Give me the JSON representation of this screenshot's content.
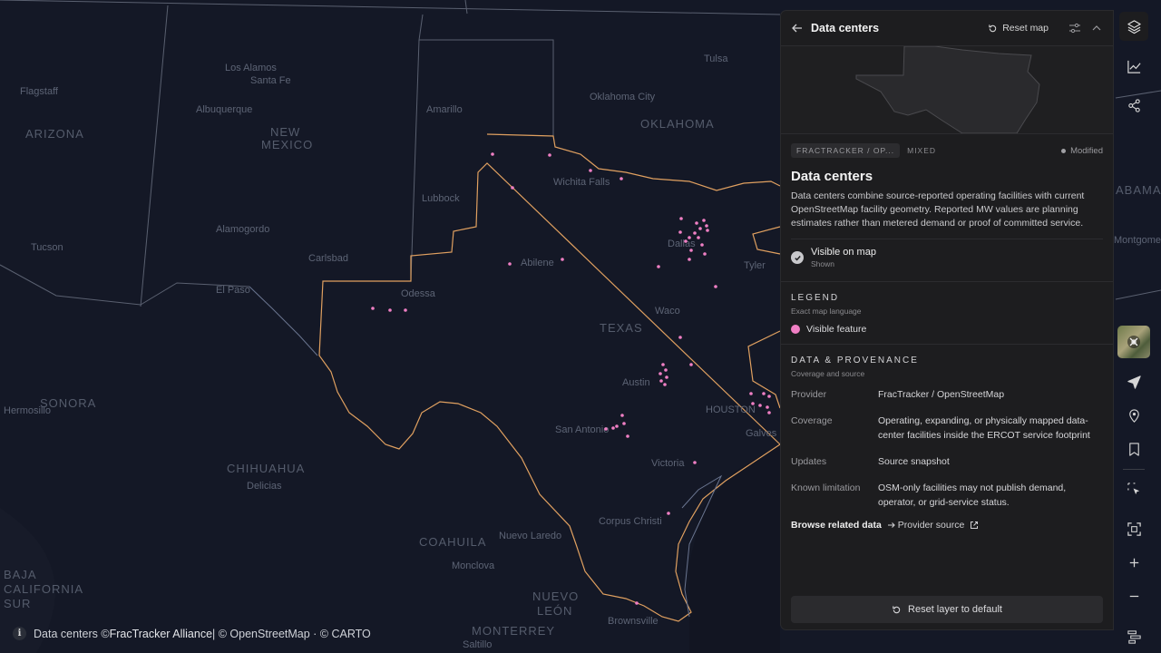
{
  "map": {
    "places": {
      "las_alamos": "Los Alamos",
      "santa_fe": "Santa Fe",
      "albuquerque": "Albuquerque",
      "flagstaff": "Flagstaff",
      "tulsa": "Tulsa",
      "oklahoma_city": "Oklahoma City",
      "amarillo": "Amarillo",
      "wichita_falls": "Wichita Falls",
      "lubbock": "Lubbock",
      "alamogordo": "Alamogordo",
      "carlsbad": "Carlsbad",
      "abilene": "Abilene",
      "dallas": "Dallas",
      "tyler": "Tyler",
      "el_paso": "El Paso",
      "odessa": "Odessa",
      "waco": "Waco",
      "austin": "Austin",
      "houston": "HOUSTON",
      "san_antonio": "San Antonio",
      "victoria": "Victoria",
      "corpus_christi": "Corpus Christi",
      "nuevo_laredo": "Nuevo Laredo",
      "monclova": "Monclova",
      "brownsville": "Brownsville",
      "saltillo": "Saltillo",
      "galveston": "Galves",
      "hermosillo": "Hermosillo",
      "tucson": "Tucson",
      "delicias": "Delicias"
    },
    "regions": {
      "arizona": "ARIZONA",
      "new_mexico_1": "NEW",
      "new_mexico_2": "MEXICO",
      "oklahoma": "OKLAHOMA",
      "texas": "TEXAS",
      "sonora": "SONORA",
      "chihuahua": "CHIHUAHUA",
      "coahuila": "COAHUILA",
      "nuevo_leon_1": "NUEVO",
      "nuevo_leon_2": "LEÓN",
      "monterrey": "MONTERREY",
      "baja_1": "BAJA",
      "baja_2": "CALIFORNIA",
      "baja_3": "SUR",
      "alabama": "ABAMA",
      "montgomery": "Montgomery"
    },
    "feature_color": "#f07fc4",
    "ercot_outline_color": "#e0a060"
  },
  "attribution": {
    "prefix": "Data centers © ",
    "provider": "FracTracker Alliance",
    "suffix": " | © OpenStreetMap · © CARTO"
  },
  "panel": {
    "header_title": "Data centers",
    "reset_map": "Reset map",
    "source_tag": "FRACTRACKER / OP...",
    "type_tag": "MIXED",
    "status": "Modified",
    "title": "Data centers",
    "description": "Data centers combine source-reported operating facilities with current OpenStreetMap facility geometry. Reported MW values are planning estimates rather than metered demand or proof of committed service.",
    "visibility_label": "Visible on map",
    "visibility_sub": "Shown",
    "legend_heading": "LEGEND",
    "legend_sub": "Exact map language",
    "legend_item": "Visible feature",
    "prov_heading": "DATA & PROVENANCE",
    "prov_sub": "Coverage and source",
    "rows": [
      {
        "key": "Provider",
        "value": "FracTracker / OpenStreetMap"
      },
      {
        "key": "Coverage",
        "value": "Operating, expanding, or physically mapped data-center facilities inside the ERCOT service footprint"
      },
      {
        "key": "Updates",
        "value": "Source snapshot"
      },
      {
        "key": "Known limitation",
        "value": "OSM-only facilities may not publish demand, operator, or grid-service status."
      }
    ],
    "browse_label": "Browse related data",
    "provider_link": "Provider source",
    "reset_layer": "Reset layer to default"
  }
}
